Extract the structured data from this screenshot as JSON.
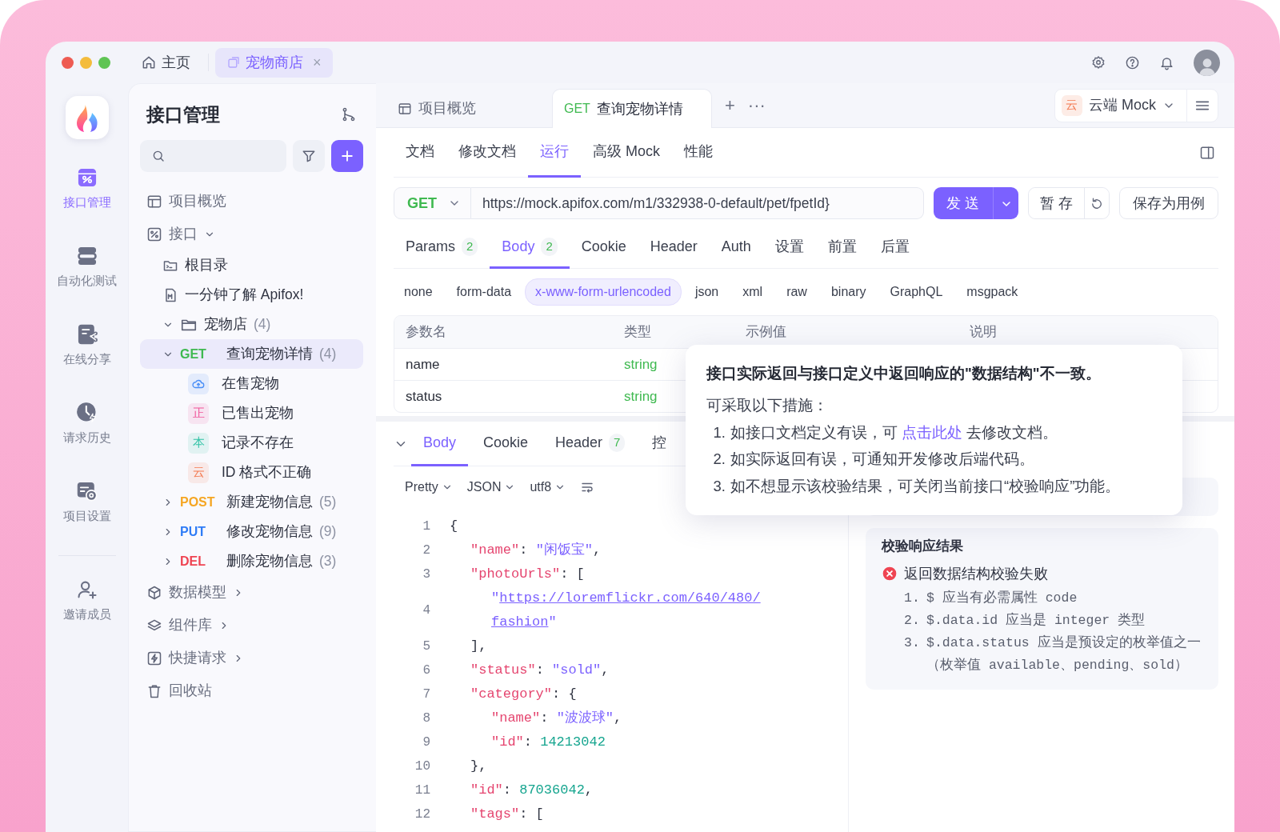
{
  "top_tabs": [
    {
      "kind": "home",
      "label": "主页",
      "selected": false
    },
    {
      "kind": "project",
      "label": "宠物商店",
      "close": "×",
      "selected": true
    }
  ],
  "rail": [
    {
      "kind": "api",
      "label": "接口管理",
      "selected": true
    },
    {
      "kind": "automation",
      "label": "自动化测试",
      "selected": false
    },
    {
      "kind": "share",
      "label": "在线分享",
      "selected": false
    },
    {
      "kind": "history",
      "label": "请求历史",
      "selected": false
    },
    {
      "kind": "settings",
      "label": "项目设置",
      "selected": false
    },
    {
      "kind": "invite",
      "label": "邀请成员",
      "selected": false
    }
  ],
  "sidebar": {
    "title": "接口管理",
    "tree": [
      {
        "kind": "page",
        "label": "项目概览",
        "selected": false
      },
      {
        "kind": "section",
        "label": "接口",
        "expanded": true,
        "selected": false,
        "children": [
          {
            "kind": "page",
            "label": "根目录",
            "selected": false
          },
          {
            "kind": "page",
            "label": "一分钟了解 Apifox!",
            "selected": false
          },
          {
            "kind": "folder",
            "label": "宠物店",
            "count": "(4)",
            "expanded": true,
            "selected": false,
            "children": [
              {
                "kind": "endpoint",
                "method": "GET",
                "color": "#3fb950",
                "label": "查询宠物详情",
                "count": "(4)",
                "expanded": true,
                "selected": true,
                "children": [
                  {
                    "kind": "case",
                    "color": "#4a8ff7",
                    "label": "在售宠物",
                    "selected": false
                  },
                  {
                    "kind": "case",
                    "badge": "正",
                    "color": "#f0569a",
                    "label": "已售出宠物",
                    "selected": false
                  },
                  {
                    "kind": "case",
                    "badge": "本",
                    "color": "#36c4a8",
                    "label": "记录不存在",
                    "selected": false
                  },
                  {
                    "kind": "case",
                    "badge": "云",
                    "color": "#f47b52",
                    "label": "ID 格式不正确",
                    "selected": false
                  }
                ]
              },
              {
                "kind": "endpoint",
                "method": "POST",
                "color": "#f5a623",
                "label": "新建宠物信息",
                "count": "(5)",
                "expanded": false,
                "selected": false
              },
              {
                "kind": "endpoint",
                "method": "PUT",
                "color": "#2f7cf6",
                "label": "修改宠物信息",
                "count": "(9)",
                "expanded": false,
                "selected": false
              },
              {
                "kind": "endpoint",
                "method": "DEL",
                "color": "#ef4452",
                "label": "删除宠物信息",
                "count": "(3)",
                "expanded": false,
                "selected": false
              }
            ]
          }
        ]
      },
      {
        "kind": "section",
        "label": "数据模型",
        "expanded": false,
        "selected": false
      },
      {
        "kind": "section",
        "label": "组件库",
        "expanded": false,
        "selected": false
      },
      {
        "kind": "section",
        "label": "快捷请求",
        "expanded": false,
        "selected": false
      },
      {
        "kind": "page",
        "label": "回收站",
        "selected": false
      }
    ]
  },
  "main": {
    "tabs": [
      {
        "kind": "overview",
        "label": "项目概览",
        "selected": false
      },
      {
        "kind": "endpoint",
        "method": "GET",
        "color": "#3fb950",
        "label": "查询宠物详情",
        "selected": true
      }
    ],
    "tab_add": "+",
    "tab_more": "···",
    "environment": {
      "badge": "云",
      "label": "云端 Mock"
    },
    "subtabs": [
      {
        "label": "文档",
        "selected": false
      },
      {
        "label": "修改文档",
        "selected": false
      },
      {
        "label": "运行",
        "selected": true
      },
      {
        "label": "高级 Mock",
        "selected": false
      },
      {
        "label": "性能",
        "selected": false
      }
    ],
    "request": {
      "method": "GET",
      "url": "https://mock.apifox.com/m1/332938-0-default/pet/fpetId}",
      "send": "发 送",
      "save": "暂 存",
      "save_case": "保存为用例"
    },
    "param_tabs": [
      {
        "label": "Params",
        "count": "2",
        "selected": false
      },
      {
        "label": "Body",
        "count": "2",
        "selected": true
      },
      {
        "label": "Cookie",
        "selected": false
      },
      {
        "label": "Header",
        "selected": false
      },
      {
        "label": "Auth",
        "selected": false
      },
      {
        "label": "设置",
        "selected": false
      },
      {
        "label": "前置",
        "selected": false
      },
      {
        "label": "后置",
        "selected": false
      }
    ],
    "body_types": [
      {
        "label": "none",
        "selected": false
      },
      {
        "label": "form-data",
        "selected": false
      },
      {
        "label": "x-www-form-urlencoded",
        "selected": true
      },
      {
        "label": "json",
        "selected": false
      },
      {
        "label": "xml",
        "selected": false
      },
      {
        "label": "raw",
        "selected": false
      },
      {
        "label": "binary",
        "selected": false
      },
      {
        "label": "GraphQL",
        "selected": false
      },
      {
        "label": "msgpack",
        "selected": false
      }
    ],
    "table": {
      "columns": [
        "参数名",
        "类型",
        "示例值",
        "说明"
      ],
      "rows": [
        [
          "name",
          "string"
        ],
        [
          "status",
          "string"
        ]
      ]
    },
    "response": {
      "tabs": [
        {
          "label": "Body",
          "selected": true
        },
        {
          "label": "Cookie",
          "selected": false
        },
        {
          "label": "Header",
          "count": "7",
          "selected": false
        },
        {
          "label": "控",
          "selected": false
        }
      ],
      "formats": [
        "Pretty",
        "JSON",
        "utf8"
      ],
      "code": [
        {
          "number": "1",
          "tokens": [
            {
              "kind": "punct",
              "text": "{"
            }
          ],
          "children": [
            {
              "number": "2",
              "tokens": [
                {
                  "kind": "key",
                  "text": "\"name\""
                },
                {
                  "kind": "punct",
                  "text": ": "
                },
                {
                  "kind": "string",
                  "text": "\"闲饭宝\""
                },
                {
                  "kind": "punct",
                  "text": ","
                }
              ]
            },
            {
              "number": "3",
              "tokens": [
                {
                  "kind": "key",
                  "text": "\"photoUrls\""
                },
                {
                  "kind": "punct",
                  "text": ": ["
                }
              ],
              "children": [
                {
                  "number": "4",
                  "rows": [
                    [
                      {
                        "kind": "string",
                        "text": "\""
                      },
                      {
                        "kind": "link",
                        "text": "https://loremflickr.com/640/480/"
                      }
                    ],
                    [
                      {
                        "kind": "link",
                        "text": "fashion"
                      },
                      {
                        "kind": "string",
                        "text": "\""
                      }
                    ]
                  ]
                }
              ]
            },
            {
              "number": "5",
              "tokens": [
                {
                  "kind": "punct",
                  "text": "],"
                }
              ]
            },
            {
              "number": "6",
              "tokens": [
                {
                  "kind": "key",
                  "text": "\"status\""
                },
                {
                  "kind": "punct",
                  "text": ": "
                },
                {
                  "kind": "string",
                  "text": "\"sold\""
                },
                {
                  "kind": "punct",
                  "text": ","
                }
              ]
            },
            {
              "number": "7",
              "tokens": [
                {
                  "kind": "key",
                  "text": "\"category\""
                },
                {
                  "kind": "punct",
                  "text": ": {"
                }
              ],
              "children": [
                {
                  "number": "8",
                  "tokens": [
                    {
                      "kind": "key",
                      "text": "\"name\""
                    },
                    {
                      "kind": "punct",
                      "text": ": "
                    },
                    {
                      "kind": "string",
                      "text": "\"波波球\""
                    },
                    {
                      "kind": "punct",
                      "text": ","
                    }
                  ]
                },
                {
                  "number": "9",
                  "tokens": [
                    {
                      "kind": "key",
                      "text": "\"id\""
                    },
                    {
                      "kind": "punct",
                      "text": ": "
                    },
                    {
                      "kind": "number",
                      "text": "14213042"
                    }
                  ]
                }
              ]
            },
            {
              "number": "10",
              "tokens": [
                {
                  "kind": "punct",
                  "text": "},"
                }
              ]
            },
            {
              "number": "11",
              "tokens": [
                {
                  "kind": "key",
                  "text": "\"id\""
                },
                {
                  "kind": "punct",
                  "text": ": "
                },
                {
                  "kind": "number",
                  "text": "87036042"
                },
                {
                  "kind": "punct",
                  "text": ","
                }
              ]
            },
            {
              "number": "12",
              "tokens": [
                {
                  "kind": "key",
                  "text": "\"tags\""
                },
                {
                  "kind": "punct",
                  "text": ": ["
                }
              ]
            }
          ]
        }
      ]
    },
    "validation": {
      "title": "校验响应结果",
      "status": "返回数据结构校验失败",
      "items": [
        {
          "number": "1.",
          "text": "$ 应当有必需属性 code"
        },
        {
          "number": "2.",
          "text": "$.data.id 应当是 integer 类型"
        },
        {
          "number": "3.",
          "text": "$.data.status 应当是预设定的枚举值之一（枚举值 available、pending、sold）"
        }
      ]
    },
    "popover": {
      "title": "接口实际返回与接口定义中返回响应的\"数据结构\"不一致。",
      "subtitle": "可采取以下措施：",
      "items": [
        {
          "number": "1.",
          "text": "如接口文档定义有误，可 ",
          "link": "点击此处",
          "after": " 去修改文档。"
        },
        {
          "number": "2.",
          "text": "如实际返回有误，可通知开发修改后端代码。"
        },
        {
          "number": "3.",
          "text": "如不想显示该校验结果，可关闭当前接口“校验响应”功能。"
        }
      ]
    }
  }
}
